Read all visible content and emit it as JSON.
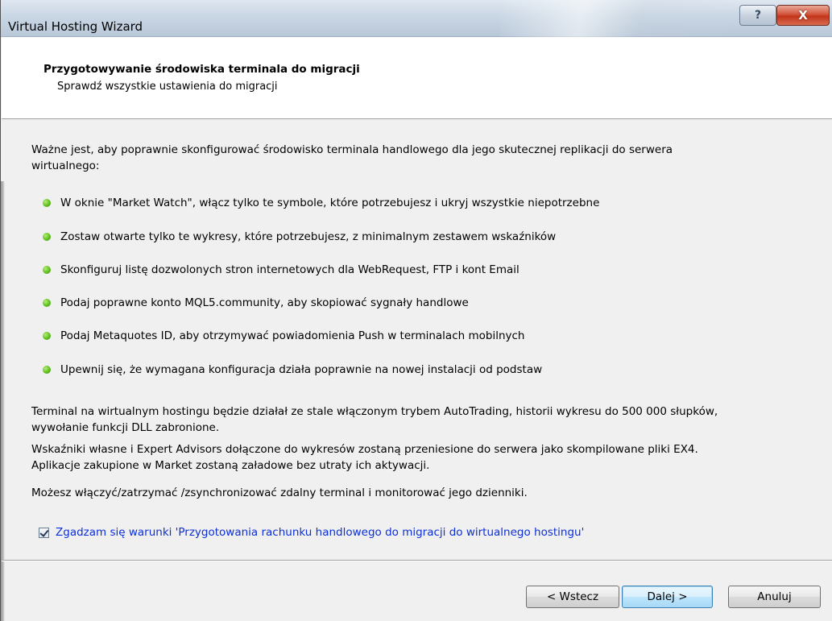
{
  "window": {
    "title": "Virtual Hosting Wizard",
    "help_label": "?",
    "close_label": "X"
  },
  "header": {
    "title": "Przygotowywanie środowiska terminala do migracji",
    "subtitle": "Sprawdź wszystkie ustawienia do migracji"
  },
  "intro": {
    "line1": "Ważne jest, aby poprawnie skonfigurować środowisko terminala handlowego dla jego skutecznej replikacji do serwera",
    "line2": "wirtualnego:"
  },
  "checklist": [
    "W oknie \"Market Watch\", włącz tylko te symbole, które potrzebujesz i ukryj wszystkie niepotrzebne",
    "Zostaw otwarte tylko te wykresy, które potrzebujesz, z minimalnym zestawem wskaźników",
    "Skonfiguruj listę dozwolonych stron internetowych dla WebRequest, FTP i kont Email",
    "Podaj poprawne konto MQL5.community, aby skopiować sygnały handlowe",
    "Podaj Metaquotes ID, aby otrzymywać powiadomienia Push w terminalach mobilnych",
    "Upewnij się, że wymagana konfiguracja działa poprawnie na nowej instalacji od podstaw"
  ],
  "notes": {
    "autotrading_line1": "Terminal na wirtualnym hostingu będzie działał ze stale włączonym trybem AutoTrading, historii wykresu do 500 000 słupków,",
    "autotrading_line2": "wywołanie funkcji DLL zabronione.",
    "indicators_line1": "Wskaźniki własne i Expert Advisors dołączone do wykresów zostaną przeniesione do serwera jako skompilowane pliki EX4.",
    "indicators_line2": "Aplikacje zakupione w Market zostaną załadowe bez utraty ich aktywacji.",
    "control": "Możesz włączyć/zatrzymać /zsynchronizować zdalny terminal i monitorować jego dzienniki."
  },
  "agreement": {
    "checked": true,
    "label": "Zgadzam się warunki 'Przygotowania rachunku handlowego do migracji do wirtualnego hostingu'"
  },
  "buttons": {
    "back": "< Wstecz",
    "next": "Dalej >",
    "cancel": "Anuluj"
  },
  "colors": {
    "bullet": "#5fbf1e",
    "agreement_text": "#0b2fd9"
  }
}
